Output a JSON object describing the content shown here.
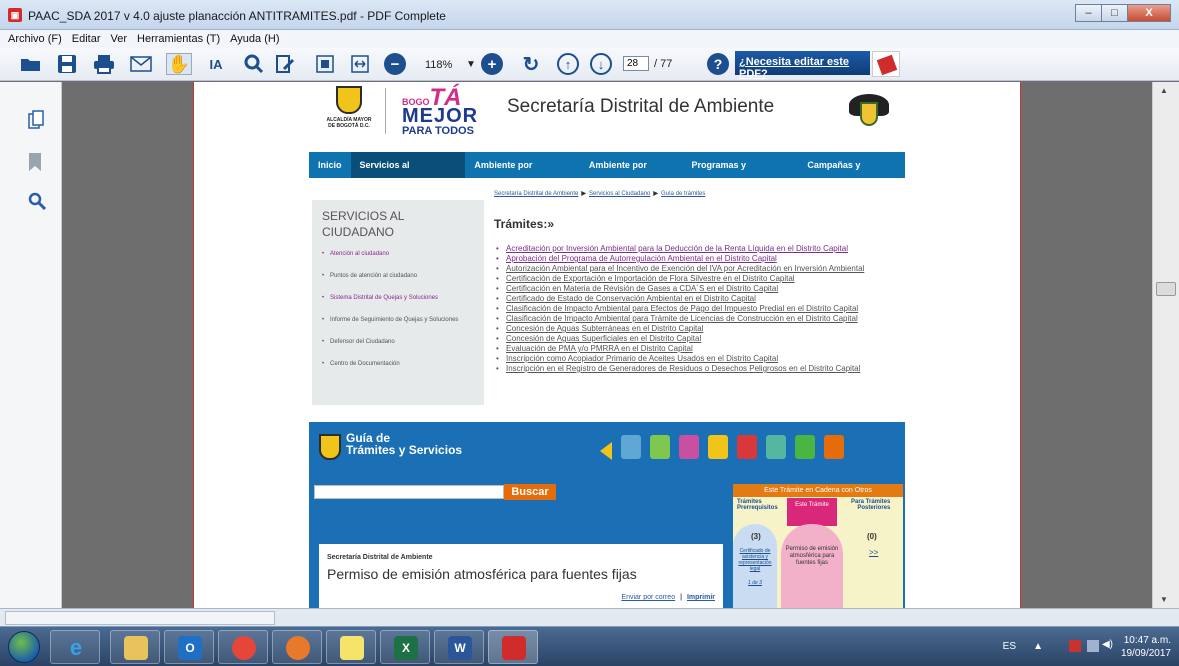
{
  "window": {
    "title": "PAAC_SDA 2017 v 4.0 ajuste planacción ANTITRAMITES.pdf - PDF Complete",
    "app_icon": "pdf-complete-icon",
    "minimize": "–",
    "maximize": "□",
    "close": "X"
  },
  "menu": [
    "Archivo (F)",
    "Editar",
    "Ver",
    "Herramientas (T)",
    "Ayuda (H)"
  ],
  "toolbar": {
    "zoom": "118%",
    "page_current": "28",
    "page_total": "/ 77",
    "help": "?",
    "banner": "¿Necesita editar este PDF?",
    "icons": [
      "open-folder-icon",
      "save-icon",
      "print-icon",
      "email-icon",
      "hand-tool-icon",
      "text-select-icon",
      "zoom-tool-icon",
      "annotate-icon",
      "fit-page-icon",
      "fit-width-icon",
      "zoom-out-icon",
      "zoom-dropdown-icon",
      "zoom-in-icon",
      "rotate-icon",
      "page-up-icon",
      "page-down-icon"
    ]
  },
  "sidepanel": {
    "icons": [
      "pages-icon",
      "bookmark-icon",
      "search-icon"
    ]
  },
  "page": {
    "header": {
      "alcaldia": "ALCALDÍA MAYOR DE BOGOTÁ D.C.",
      "bogota_small": "BOGO",
      "bogota_big": "TÁ",
      "mejor": "MEJOR",
      "para_todos": "PARA TODOS",
      "site_title": "Secretaría Distrital de Ambiente"
    },
    "nav": [
      "Inicio",
      "Servicios al Ciudadano",
      "Ambiente por recursos",
      "Ambiente por temas",
      "Programas y proyectos",
      "Campañas y Eventos"
    ],
    "breadcrumb": [
      "Secretaría Distrital de Ambiente",
      "Servicios al Ciudadano",
      "Guía de trámites"
    ],
    "breadcrumb_sep": "▶",
    "left_menu": {
      "heading": "SERVICIOS AL CIUDADANO",
      "items": [
        "Atención al ciudadano",
        "Puntos de atención al ciudadano",
        "Sistema Distrital de Quejas y Soluciones",
        "Informe de Seguimiento de Quejas y Soluciones",
        "Defensor del Ciudadano",
        "Centro de Documentación"
      ]
    },
    "tramites_heading": "Trámites:»",
    "tramites": [
      "Acreditación por Inversión Ambiental para la Deducción de la Renta Líquida en el Distrito Capital",
      "Aprobación del Programa de Autorregulación Ambiental en el Distrito Capital",
      "Autorización Ambiental para el Incentivo de Exención del IVA por Acreditación en Inversión Ambiental",
      "Certificación de Exportación e Importación de Flora Silvestre en el Distrito Capital",
      "Certificación en Materia de Revisión de Gases a CDA´S en el Distrito Capital",
      "Certificado de Estado de Conservación Ambiental en el Distrito Capital",
      "Clasificación de Impacto Ambiental para Efectos de Pago del Impuesto Predial en el Distrito Capital",
      "Clasificación de Impacto Ambiental para Trámite de Licencias de Construcción en el Distrito Capital",
      "Concesión de Aguas Subterráneas en el Distrito Capital",
      "Concesión de Aguas Superficiales en el Distrito Capital",
      "Evaluación de PMA y/o PMRRA en el Distrito Capital",
      "Inscripción como Acopiador Primario de Aceites Usados en el Distrito Capital",
      "Inscripción en el Registro de Generadores de Residuos o Desechos Peligrosos en el Distrito Capital"
    ],
    "guide": {
      "title_line1": "Guía de",
      "title_line2": "Trámites y Servicios",
      "buscar": "Buscar",
      "entity": "Secretaría Distrital de Ambiente",
      "permiso": "Permiso de emisión atmosférica para fuentes fijas",
      "email_link": "Enviar por correo",
      "link_sep": "|",
      "print_link": "Imprimir",
      "panel_title": "Este Trámite en Cadena con Otros",
      "col_tramites": "Trámites",
      "col_prerreq": "Prerrequisitos",
      "col_este": "Este Trámite",
      "col_para": "Para Trámites",
      "col_post": "Posteriores",
      "count_pre": "(3)",
      "count_post": "(0)",
      "more": ">>",
      "pre_item": "Certificado de asistencia y representación legal",
      "pre_pager": "1 de 3",
      "este_item": "Permiso de emisión atmosférica para fuentes fijas"
    }
  },
  "taskbar": {
    "apps": [
      "internet-explorer-icon",
      "file-explorer-icon",
      "outlook-icon",
      "chrome-icon",
      "firefox-icon",
      "sticky-notes-icon",
      "excel-icon",
      "word-icon",
      "pdf-complete-icon"
    ],
    "lang": "ES",
    "time": "10:47 a.m.",
    "date": "19/09/2017"
  },
  "colors": {
    "nav_blue": "#0f73b0",
    "guide_blue": "#1a6fb5",
    "buscar_orange": "#e46c0a",
    "page_border": "#c8332f"
  }
}
